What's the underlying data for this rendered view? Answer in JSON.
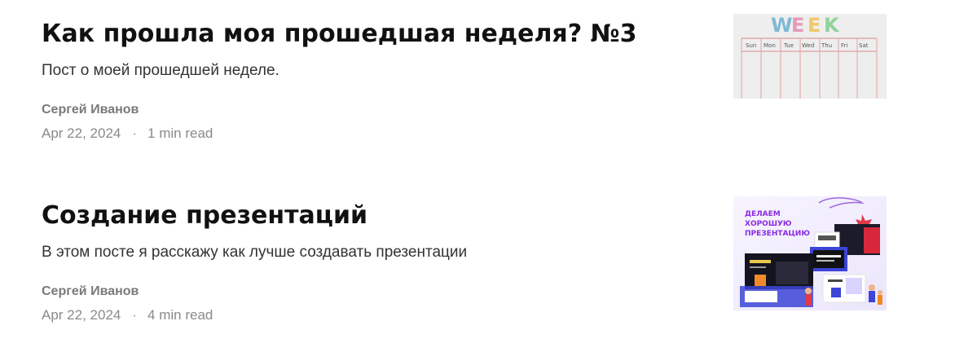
{
  "posts": [
    {
      "title": "Как прошла моя прошедшая неделя? №3",
      "excerpt": "Пост о моей прошедшей неделе.",
      "author": "Сергей Иванов",
      "date": "Apr 22, 2024",
      "separator": "·",
      "read_time": "1 min read",
      "thumbnail": {
        "subject": "weekly-calendar-image",
        "heading": "WEEK",
        "days": [
          "Sun",
          "Mon",
          "Tue",
          "Wed",
          "Thu",
          "Fri",
          "Sat"
        ]
      }
    },
    {
      "title": "Создание презентаций",
      "excerpt": "В этом посте я расскажу как лучше создавать презентации",
      "author": "Сергей Иванов",
      "date": "Apr 22, 2024",
      "separator": "·",
      "read_time": "4 min read",
      "thumbnail": {
        "subject": "presentation-design-banner",
        "heading_lines": [
          "ДЕЛАЕМ",
          "ХОРОШУЮ",
          "ПРЕЗЕНТАЦИЮ"
        ],
        "accent_color": "#8a2be2"
      }
    }
  ]
}
